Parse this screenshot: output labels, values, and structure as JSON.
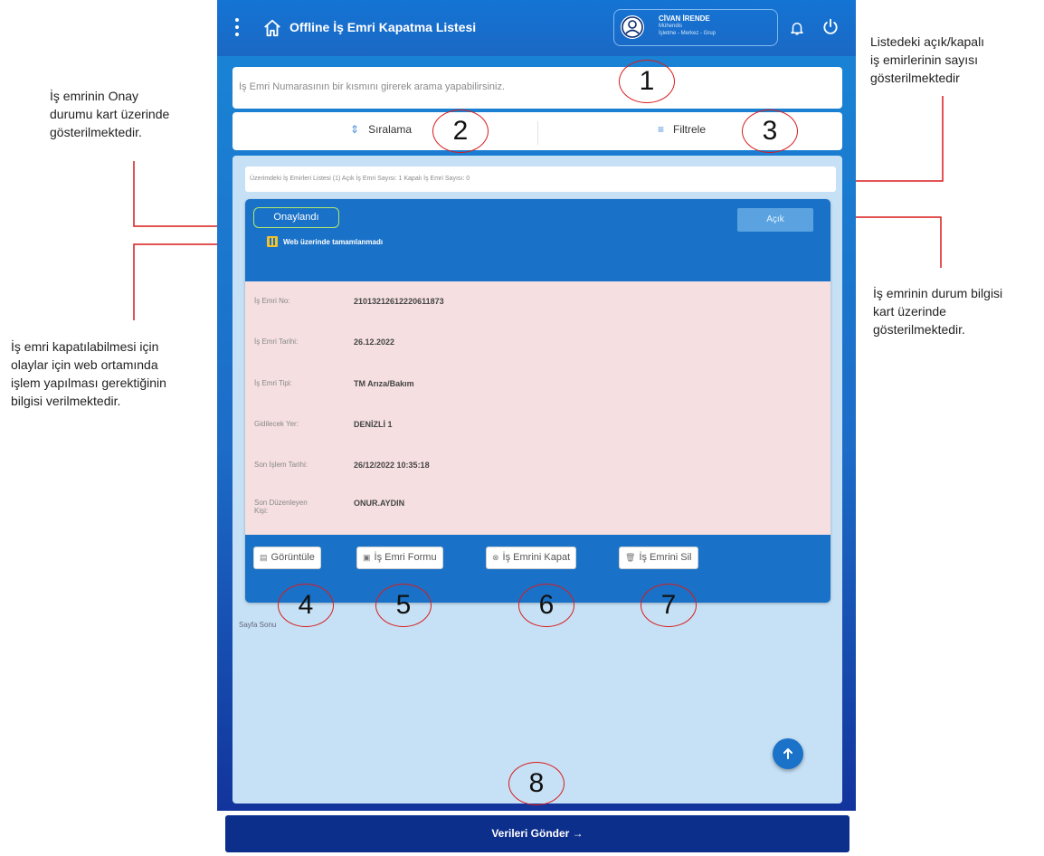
{
  "header": {
    "title": "Offline İş Emri Kapatma Listesi",
    "user": {
      "name": "CİVAN İRENDE",
      "role": "Mühendis",
      "department": "İşletme - Merkez - Grup"
    }
  },
  "search": {
    "placeholder": "İş Emri Numarasının bir kısmını girerek arama yapabilirsiniz."
  },
  "toolbar": {
    "sort_label": "Sıralama",
    "filter_label": "Filtrele"
  },
  "summary": {
    "count_text": "Üzerimdeki İş Emirleri Listesi (1) Açık İş Emri Sayısı: 1 Kapalı İş Emri Sayısı: 0"
  },
  "card": {
    "approval_status": "Onaylandı",
    "status": "Açık",
    "web_warning": "Web üzerinde tamamlanmadı",
    "fields": [
      {
        "label": "İş Emri No:",
        "value": "21013212612220611873"
      },
      {
        "label": "İş Emri Tarihi:",
        "value": "26.12.2022"
      },
      {
        "label": "İş Emri Tipi:",
        "value": "TM Arıza/Bakım"
      },
      {
        "label": "Gidilecek Yer:",
        "value": "DENİZLİ 1"
      },
      {
        "label": "Son İşlem Tarihi:",
        "value": "26/12/2022 10:35:18"
      },
      {
        "label": "Son Düzenleyen Kişi:",
        "value": "ONUR.AYDIN"
      }
    ],
    "actions": {
      "view": "Görüntüle",
      "form": "İş Emri Formu",
      "close": "İş Emrini Kapat",
      "delete": "İş Emrini Sil"
    }
  },
  "list": {
    "page_end": "Sayfa Sonu"
  },
  "footer": {
    "send_label": "Verileri Gönder →"
  },
  "annotations": {
    "approval_note": "İş emrinin Onay\ndurumu kart üzerinde\ngösterilmektedir.",
    "web_note": "İş emri kapatılabilmesi için\nolaylar için web ortamında\nişlem yapılması gerektiğinin\nbilgisi verilmektedir.",
    "count_note": "Listedeki açık/kapalı\niş emirlerinin sayısı\ngösterilmektedir",
    "status_note": "İş emrinin durum bilgisi\n kart üzerinde\ngösterilmektedir.",
    "markers": [
      "1",
      "2",
      "3",
      "4",
      "5",
      "6",
      "7",
      "8"
    ]
  },
  "colors": {
    "header_blue": "#1474d4",
    "footer_navy": "#0d2f8c",
    "card_detail_bg": "#f5dfe0",
    "approval_border": "#aee66e",
    "annotation_red": "#d91b1b"
  }
}
